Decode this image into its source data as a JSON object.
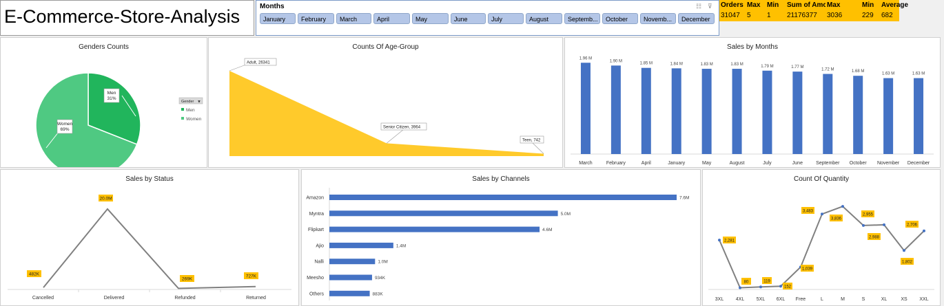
{
  "header": {
    "title": "E-Commerce-Store-Analysis"
  },
  "slicer": {
    "label": "Months",
    "items": [
      "January",
      "February",
      "March",
      "April",
      "May",
      "June",
      "July",
      "August",
      "Septemb...",
      "October",
      "Novemb...",
      "December"
    ]
  },
  "stats": {
    "headers": [
      "Orders",
      "Max",
      "Min",
      "Sum of Amount",
      "Max",
      "Min",
      "Average"
    ],
    "values": [
      "31047",
      "5",
      "1",
      "21176377",
      "3036",
      "229",
      "682"
    ],
    "colors": {
      "header_bg": "#ffc000",
      "value_bg": "#ffc000"
    }
  },
  "colors": {
    "blue": "#4472c4",
    "yellow": "#ffca2b",
    "green_dark": "#21b55c",
    "green_light": "#4fc982",
    "gray_line": "#808080",
    "label_bg": "#ffc000"
  },
  "chart_data": [
    {
      "id": "gender",
      "type": "pie",
      "title": "Genders Counts",
      "categories": [
        "Men",
        "Women"
      ],
      "values": [
        31,
        69
      ],
      "data_labels": [
        [
          "Men",
          "31%"
        ],
        [
          "Women",
          "69%"
        ]
      ],
      "legend": {
        "title": "Gender",
        "entries": [
          "Men",
          "Women"
        ],
        "placement": "right"
      }
    },
    {
      "id": "age",
      "type": "area",
      "title": "Counts Of  Age-Group",
      "categories": [
        "Adult",
        "Senior Citizen",
        "Teen"
      ],
      "values": [
        26341,
        3964,
        742
      ],
      "data_labels": [
        "Adult, 26341",
        "Senior Citizen, 3964",
        "Teen, 742"
      ]
    },
    {
      "id": "months",
      "type": "bar",
      "title": "Sales by Months",
      "categories": [
        "March",
        "February",
        "April",
        "January",
        "May",
        "August",
        "July",
        "June",
        "September",
        "October",
        "November",
        "December"
      ],
      "values": [
        1.96,
        1.9,
        1.85,
        1.84,
        1.83,
        1.83,
        1.79,
        1.77,
        1.72,
        1.68,
        1.63,
        1.63
      ],
      "data_labels": [
        "1.96 M",
        "1.90 M",
        "1.85 M",
        "1.84 M",
        "1.83 M",
        "1.83 M",
        "1.79 M",
        "1.77 M",
        "1.72 M",
        "1.68 M",
        "1.63 M",
        "1.63 M"
      ],
      "ylim": [
        0,
        2.2
      ]
    },
    {
      "id": "status",
      "type": "line",
      "title": "Sales by Status",
      "categories": [
        "Cancelled",
        "Delivered",
        "Refunded",
        "Returned"
      ],
      "values": [
        0.482,
        20.0,
        0.269,
        0.727
      ],
      "data_labels": [
        "482K",
        "20.0M",
        "269K",
        "727K"
      ],
      "ylim": [
        0,
        21
      ]
    },
    {
      "id": "channels",
      "type": "bar",
      "orientation": "horizontal",
      "title": "Sales by Channels",
      "categories": [
        "Amazon",
        "Myntra",
        "Flipkart",
        "Ajio",
        "Nalli",
        "Meesho",
        "Others"
      ],
      "values": [
        7.6,
        5.0,
        4.6,
        1.4,
        1.0,
        0.934,
        0.883
      ],
      "data_labels": [
        "7.6M",
        "5.0M",
        "4.6M",
        "1.4M",
        "1.0M",
        "934K",
        "883K"
      ],
      "xlim": [
        0,
        8
      ]
    },
    {
      "id": "quantity",
      "type": "line",
      "title": "Count Of Quantity",
      "categories": [
        "3XL",
        "4XL",
        "5XL",
        "6XL",
        "Free",
        "L",
        "M",
        "S",
        "XL",
        "XS",
        "XXL"
      ],
      "values": [
        2281,
        80,
        119,
        152,
        1039,
        3483,
        3836,
        2955,
        2988,
        1802,
        2706
      ],
      "data_labels": [
        "2,281",
        "80",
        "119",
        "152",
        "1,039",
        "3,483",
        "3,836",
        "2,955",
        "2,988",
        "1,802",
        "2,706"
      ],
      "ylim": [
        0,
        4000
      ]
    }
  ]
}
